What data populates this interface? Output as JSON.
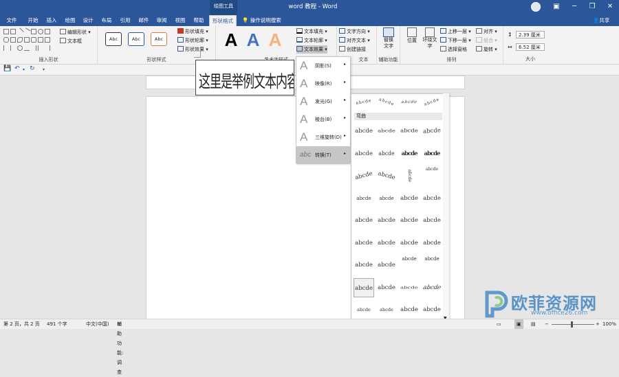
{
  "titlebar": {
    "tool_label": "绘图工具",
    "doc_title": "word 教程  -  Word",
    "controls": {
      "ribbon_opts": "▣",
      "minimize": "─",
      "restore": "❐",
      "close": "✕"
    }
  },
  "tabs": [
    {
      "label": "文件"
    },
    {
      "label": "开始"
    },
    {
      "label": "插入"
    },
    {
      "label": "绘图"
    },
    {
      "label": "设计"
    },
    {
      "label": "布局"
    },
    {
      "label": "引用"
    },
    {
      "label": "邮件"
    },
    {
      "label": "审阅"
    },
    {
      "label": "视图"
    },
    {
      "label": "帮助"
    },
    {
      "label": "形状格式"
    }
  ],
  "search": {
    "label": "操作说明搜索",
    "icon": "lightbulb-icon"
  },
  "share": {
    "label": "共享"
  },
  "ribbon": {
    "insert_shapes": {
      "label": "插入形状",
      "edit_shape": "编辑形状",
      "textbox": "文本框"
    },
    "shape_styles": {
      "label": "形状样式",
      "style_boxes": [
        "Abc",
        "Abc",
        "Abc"
      ],
      "fill": "形状填充",
      "outline": "形状轮廓",
      "effects": "形状效果"
    },
    "wordart": {
      "label": "艺术字样式",
      "letters": [
        "A",
        "A",
        "A"
      ],
      "text_fill": "文本填充",
      "text_outline": "文本轮廓",
      "text_effects": "文本效果"
    },
    "text": {
      "label": "文本",
      "direction": "文字方向",
      "align": "对齐文本",
      "link": "创建链接"
    },
    "accessibility": {
      "label": "辅助功能",
      "alt_text_l1": "替换",
      "alt_text_l2": "文字"
    },
    "arrange": {
      "label": "排列",
      "position": "位置",
      "wrap_l1": "环绕文",
      "wrap_l2": "字",
      "bring_forward": "上移一层",
      "send_backward": "下移一层",
      "selection_pane": "选择窗格",
      "align": "对齐",
      "group": "组合",
      "rotate": "旋转"
    },
    "size": {
      "label": "大小",
      "height": "2.39 厘米",
      "width": "6.52 厘米"
    }
  },
  "document": {
    "textbox_text": "这里是举例文本内容。"
  },
  "effects_menu": [
    {
      "label": "阴影(S)",
      "icon": "A"
    },
    {
      "label": "映像(R)",
      "icon": "A"
    },
    {
      "label": "发光(G)",
      "icon": "A"
    },
    {
      "label": "棱台(B)",
      "icon": "A"
    },
    {
      "label": "三维旋转(D)",
      "icon": "A"
    },
    {
      "label": "转换(T)",
      "icon": "abc",
      "active": true
    }
  ],
  "transform_gallery": {
    "section_label": "弯曲",
    "sample": "abcde",
    "selected_index": 28
  },
  "statusbar": {
    "page": "第 2 页，共 2 页",
    "words": "491 个字",
    "language": "中文(中国)",
    "accessibility": "辅助功能: 调查",
    "zoom": "100%"
  },
  "watermark": {
    "text": "欧菲资源网",
    "url": "www.office26.com"
  },
  "colors": {
    "brand": "#2b579a",
    "ribbon_bg": "#f3f3f3",
    "wordart_blue": "#4472c4",
    "wordart_orange": "#f4b183"
  }
}
